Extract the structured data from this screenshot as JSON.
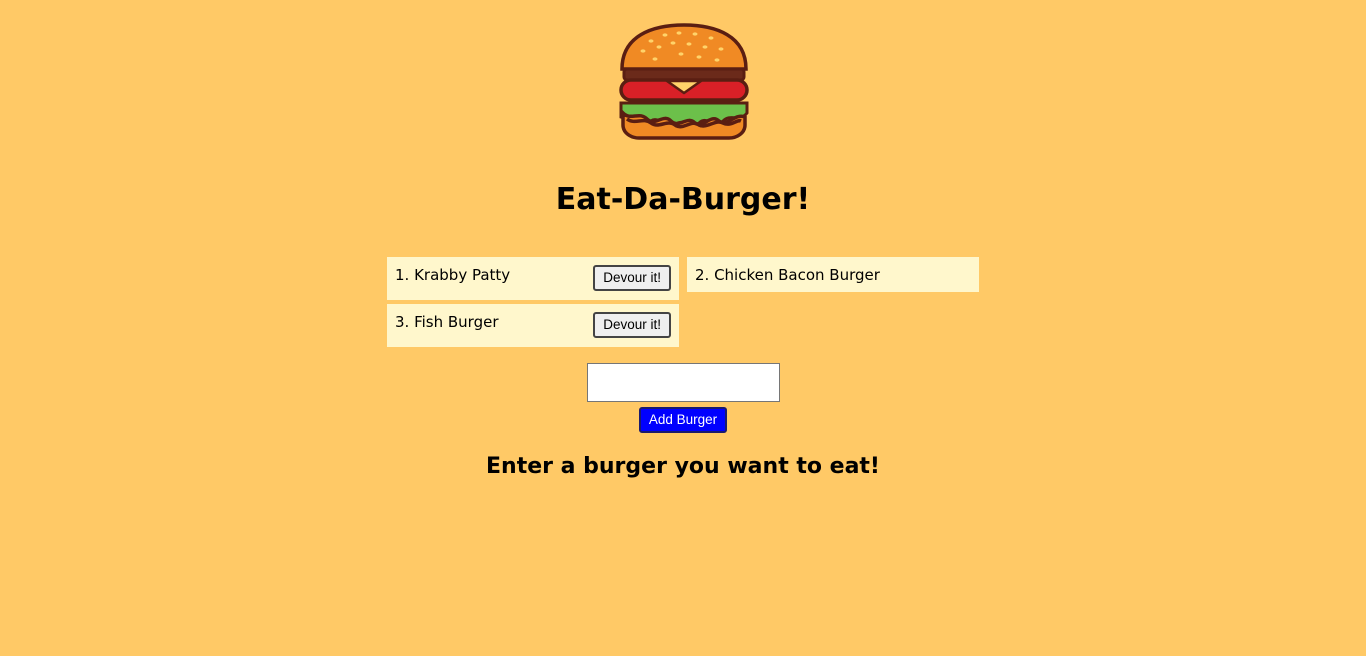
{
  "header": {
    "logo_icon": "burger-icon",
    "title": "Eat-Da-Burger!"
  },
  "burgers": [
    {
      "label": "1. Krabby Patty",
      "action": "Devour it!",
      "devoured": false
    },
    {
      "label": "2. Chicken Bacon Burger",
      "devoured": true
    },
    {
      "label": "3. Fish Burger",
      "action": "Devour it!",
      "devoured": false
    }
  ],
  "form": {
    "input_value": "",
    "input_placeholder": "",
    "submit_label": "Add Burger",
    "prompt": "Enter a burger you want to eat!"
  },
  "colors": {
    "background": "#FFC966",
    "card": "#FFF7CC",
    "add_button": "#0000FF"
  }
}
